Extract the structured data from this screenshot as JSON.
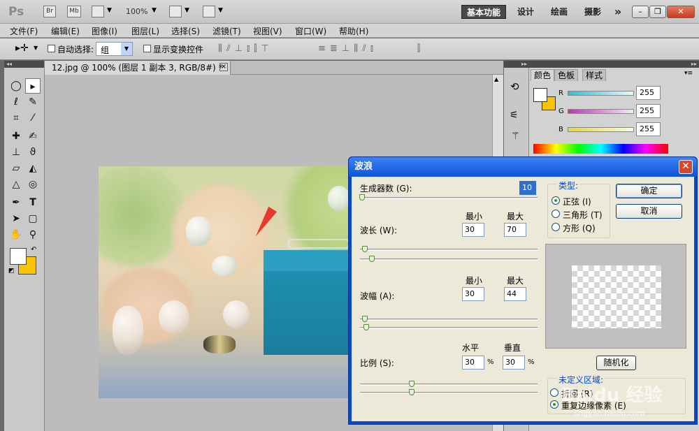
{
  "app": {
    "logo": "Ps",
    "bridge_btn": "Br",
    "minibridge_btn": "Mb",
    "zoom": "100%",
    "workspaces": [
      "基本功能",
      "设计",
      "绘画",
      "摄影"
    ],
    "more": "»"
  },
  "menu": [
    "文件(F)",
    "编辑(E)",
    "图像(I)",
    "图层(L)",
    "选择(S)",
    "滤镜(T)",
    "视图(V)",
    "窗口(W)",
    "帮助(H)"
  ],
  "options": {
    "auto_select_label": "自动选择:",
    "auto_select_value": "组",
    "show_transform_label": "显示变换控件"
  },
  "document": {
    "tab_title": "12.jpg @ 100% (图层 1 副本 3, RGB/8#) *",
    "close_glyph": "×"
  },
  "panel": {
    "tabs": [
      "颜色",
      "色板",
      "样式"
    ],
    "channels": [
      {
        "name": "R",
        "value": "255",
        "color": "#34c7dd"
      },
      {
        "name": "G",
        "value": "255",
        "color": "#d23ad0"
      },
      {
        "name": "B",
        "value": "255",
        "color": "#e7e23a"
      }
    ]
  },
  "dialog": {
    "title": "波浪",
    "generators_label": "生成器数 (G):",
    "generators_value": "10",
    "min_label": "最小",
    "max_label": "最大",
    "wavelength_label": "波长 (W):",
    "wavelength_min": "30",
    "wavelength_max": "70",
    "amplitude_label": "波幅 (A):",
    "amplitude_min": "30",
    "amplitude_max": "44",
    "horizontal_label": "水平",
    "vertical_label": "垂直",
    "scale_label": "比例 (S):",
    "scale_h": "30",
    "scale_v": "30",
    "percent": "%",
    "type_label": "类型:",
    "types": [
      "正弦 (I)",
      "三角形 (T)",
      "方形 (Q)"
    ],
    "ok": "确定",
    "cancel": "取消",
    "randomize": "随机化",
    "undefined_area_label": "未定义区域:",
    "undefined_options": [
      "折回 (R)",
      "重复边缘像素 (E)"
    ],
    "watermark": "Baidu 经验",
    "watermark_url": "jingyan.baidu.com"
  }
}
